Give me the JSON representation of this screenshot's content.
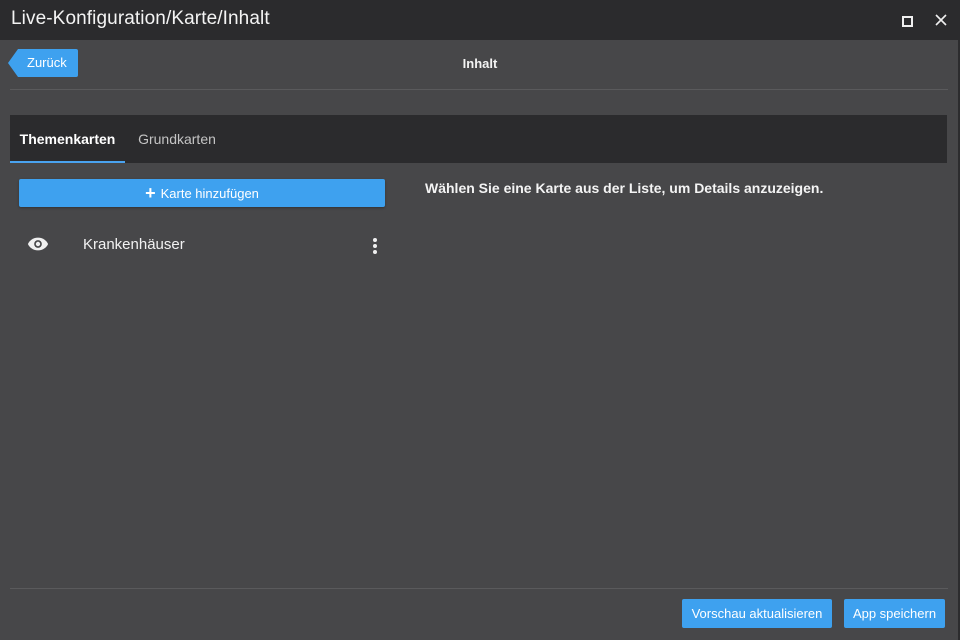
{
  "window": {
    "title": "Live-Konfiguration/Karte/Inhalt",
    "controls": {
      "maximize_icon": "maximize-icon",
      "close_icon": "close-icon"
    }
  },
  "header": {
    "back_label": "Zurück",
    "page_title": "Inhalt"
  },
  "tabs": [
    {
      "label": "Themenkarten",
      "active": true
    },
    {
      "label": "Grundkarten",
      "active": false
    }
  ],
  "left_panel": {
    "add_button_label": "Karte hinzufügen",
    "add_button_icon": "plus-icon",
    "items": [
      {
        "label": "Krankenhäuser",
        "visibility_icon": "eye-icon",
        "menu_icon": "more-vertical-icon"
      }
    ]
  },
  "right_panel": {
    "hint": "Wählen Sie eine Karte aus der Liste, um Details anzuzeigen."
  },
  "footer": {
    "preview_label": "Vorschau aktualisieren",
    "save_label": "App speichern"
  },
  "colors": {
    "accent": "#3ea1ef",
    "background": "#474749",
    "titlebar": "#2b2b2d"
  }
}
